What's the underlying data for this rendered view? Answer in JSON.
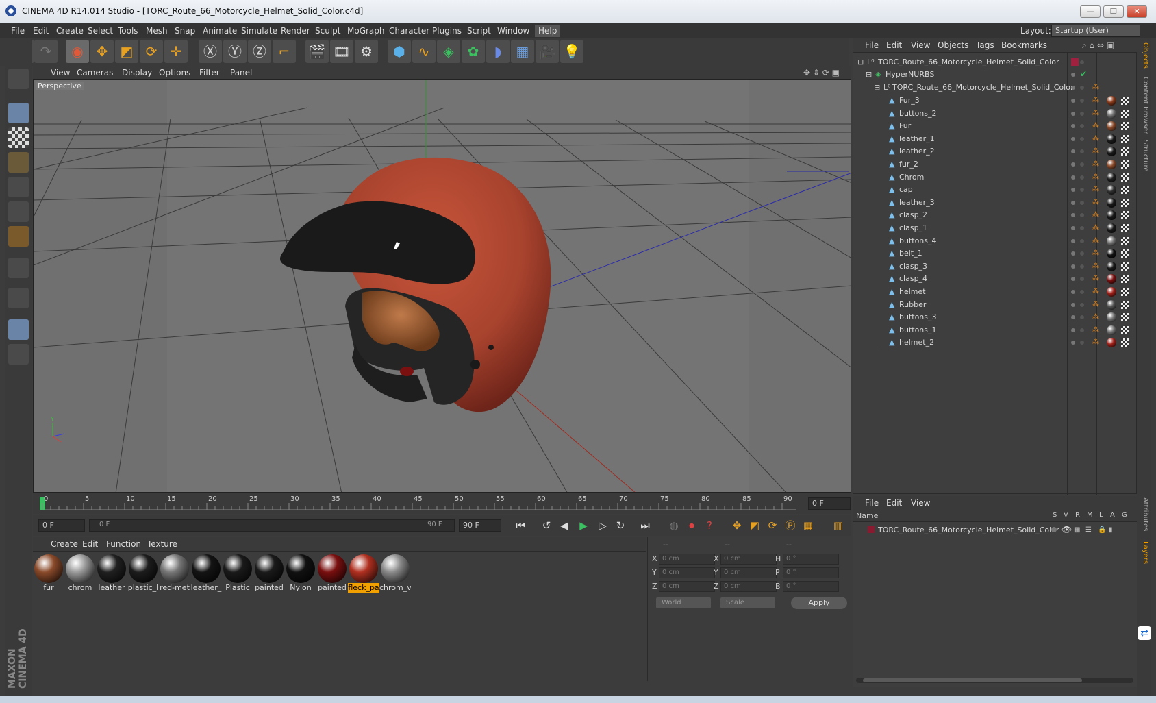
{
  "window": {
    "title": "CINEMA 4D R14.014 Studio - [TORC_Route_66_Motorcycle_Helmet_Solid_Color.c4d]",
    "minimize": "—",
    "maximize": "❐",
    "close": "✕"
  },
  "menubar": {
    "items": [
      "File",
      "Edit",
      "Create",
      "Select",
      "Tools",
      "Mesh",
      "Snap",
      "Animate",
      "Simulate",
      "Render",
      "Sculpt",
      "MoGraph",
      "Character",
      "Plugins",
      "Script",
      "Window",
      "Help"
    ],
    "layout_label": "Layout:",
    "layout_value": "Startup (User)"
  },
  "viewport": {
    "menu": [
      "View",
      "Cameras",
      "Display",
      "Options",
      "Filter",
      "Panel"
    ],
    "label": "Perspective"
  },
  "timeline": {
    "ticks": [
      "0",
      "5",
      "10",
      "15",
      "20",
      "25",
      "30",
      "35",
      "40",
      "45",
      "50",
      "55",
      "60",
      "65",
      "70",
      "75",
      "80",
      "85",
      "90"
    ],
    "current_frame": "0 F"
  },
  "transport": {
    "start_field": "0 F",
    "range_start": "0 F",
    "range_end": "90 F",
    "end_field": "90 F"
  },
  "materials": {
    "menu": [
      "Create",
      "Edit",
      "Function",
      "Texture"
    ],
    "items": [
      {
        "name": "fur",
        "color": "#8a4a2a"
      },
      {
        "name": "chrom",
        "color": "#9a9a9a"
      },
      {
        "name": "leather",
        "color": "#202020"
      },
      {
        "name": "plastic_l",
        "color": "#1c1c1c"
      },
      {
        "name": "red-met",
        "color": "#777777"
      },
      {
        "name": "leather_",
        "color": "#141414"
      },
      {
        "name": "Plastic",
        "color": "#1a1a1a"
      },
      {
        "name": "painted",
        "color": "#1a1a1a"
      },
      {
        "name": "Nylon",
        "color": "#111111"
      },
      {
        "name": "painted",
        "color": "#7a0f0f"
      },
      {
        "name": "fleck_pa",
        "color": "#b03020"
      },
      {
        "name": "chrom_v",
        "color": "#8a8a8a"
      }
    ],
    "selected_index": 10
  },
  "coords": {
    "col_headers": [
      "--",
      "--",
      "--"
    ],
    "rows": [
      {
        "a": "X",
        "av": "0 cm",
        "b": "X",
        "bv": "0 cm",
        "c": "H",
        "cv": "0 °"
      },
      {
        "a": "Y",
        "av": "0 cm",
        "b": "Y",
        "bv": "0 cm",
        "c": "P",
        "cv": "0 °"
      },
      {
        "a": "Z",
        "av": "0 cm",
        "b": "Z",
        "bv": "0 cm",
        "c": "B",
        "cv": "0 °"
      }
    ],
    "mode": "World",
    "transform": "Scale",
    "apply": "Apply"
  },
  "objects": {
    "menu": [
      "File",
      "Edit",
      "View",
      "Objects",
      "Tags",
      "Bookmarks"
    ],
    "root": "TORC_Route_66_Motorcycle_Helmet_Solid_Color",
    "hypernurbs": "HyperNURBS",
    "group": "TORC_Route_66_Motorcycle_Helmet_Solid_Color",
    "children": [
      {
        "name": "Fur_3",
        "color": "#8a3a1a"
      },
      {
        "name": "buttons_2",
        "color": "#777777"
      },
      {
        "name": "Fur",
        "color": "#8a4a2a"
      },
      {
        "name": "leather_1",
        "color": "#1a1a1a"
      },
      {
        "name": "leather_2",
        "color": "#1a1a1a"
      },
      {
        "name": "fur_2",
        "color": "#8a4a2a"
      },
      {
        "name": "Chrom",
        "color": "#202020"
      },
      {
        "name": "cap",
        "color": "#303030"
      },
      {
        "name": "leather_3",
        "color": "#1a1a1a"
      },
      {
        "name": "clasp_2",
        "color": "#1a1a1a"
      },
      {
        "name": "clasp_1",
        "color": "#1a1a1a"
      },
      {
        "name": "buttons_4",
        "color": "#777777"
      },
      {
        "name": "belt_1",
        "color": "#111111"
      },
      {
        "name": "clasp_3",
        "color": "#1a1a1a"
      },
      {
        "name": "clasp_4",
        "color": "#7a0f0f"
      },
      {
        "name": "helmet",
        "color": "#a02018"
      },
      {
        "name": "Rubber",
        "color": "#555555"
      },
      {
        "name": "buttons_3",
        "color": "#777777"
      },
      {
        "name": "buttons_1",
        "color": "#777777"
      },
      {
        "name": "helmet_2",
        "color": "#a02018"
      }
    ]
  },
  "layers": {
    "menu": [
      "File",
      "Edit",
      "View"
    ],
    "headers": {
      "name": "Name",
      "flags": [
        "S",
        "V",
        "R",
        "M",
        "L",
        "A",
        "G"
      ]
    },
    "item": "TORC_Route_66_Motorcycle_Helmet_Solid_Color"
  },
  "sidebar_tabs": [
    "Objects",
    "Content Browser",
    "Structure",
    "Attributes",
    "Layers"
  ],
  "branding": "MAXON CINEMA 4D",
  "colors": {
    "accent": "#f0a000",
    "selection": "#6a84a8",
    "helmet_red": "#a8432e"
  }
}
